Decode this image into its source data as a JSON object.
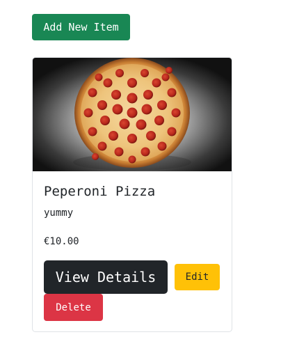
{
  "toolbar": {
    "add_label": "Add New Item"
  },
  "item": {
    "image_alt": "pepperoni pizza photo",
    "title": "Peperoni Pizza",
    "description": "yummy",
    "price": "€10.00",
    "view_label": "View Details",
    "edit_label": "Edit",
    "delete_label": "Delete"
  },
  "colors": {
    "add_button": "#198754",
    "view_button": "#212529",
    "edit_button": "#ffc107",
    "delete_button": "#dc3545"
  }
}
